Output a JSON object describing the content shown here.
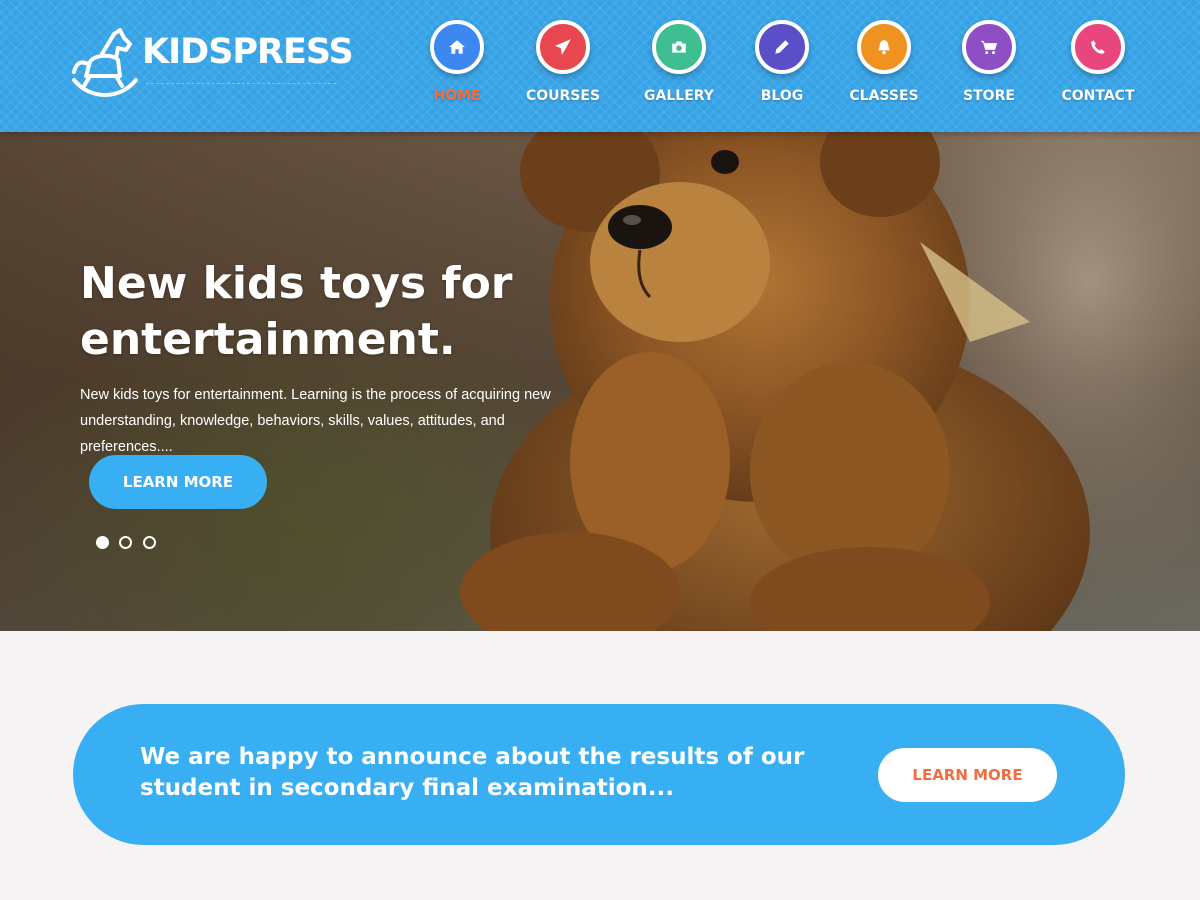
{
  "site": {
    "logo_text": "KIDSPRESS"
  },
  "nav": [
    {
      "label": "HOME",
      "icon": "home-icon",
      "color": "#3d88f0",
      "active": true
    },
    {
      "label": "COURSES",
      "icon": "paper-plane-icon",
      "color": "#e9474f",
      "active": false
    },
    {
      "label": "GALLERY",
      "icon": "camera-icon",
      "color": "#3fbf91",
      "active": false
    },
    {
      "label": "BLOG",
      "icon": "pencil-icon",
      "color": "#5a4fc7",
      "active": false
    },
    {
      "label": "CLASSES",
      "icon": "bell-icon",
      "color": "#ef9220",
      "active": false
    },
    {
      "label": "STORE",
      "icon": "cart-icon",
      "color": "#8e4fc4",
      "active": false
    },
    {
      "label": "CONTACT",
      "icon": "phone-icon",
      "color": "#e9457e",
      "active": false
    }
  ],
  "hero": {
    "title": "New kids toys for entertainment.",
    "description": "New kids toys for entertainment. Learning is the process of acquiring new understanding, knowledge, behaviors, skills, values, attitudes, and preferences....",
    "button_label": "LEARN MORE",
    "slides_count": 3,
    "active_slide": 1
  },
  "announcement": {
    "text": "We are happy to announce about the results of our student in secondary final examination...",
    "button_label": "LEARN MORE"
  },
  "colors": {
    "header_bg": "#36a3e6",
    "accent_blue": "#38aef3",
    "accent_orange": "#f36d3e",
    "page_bg": "#f5f3f4"
  }
}
